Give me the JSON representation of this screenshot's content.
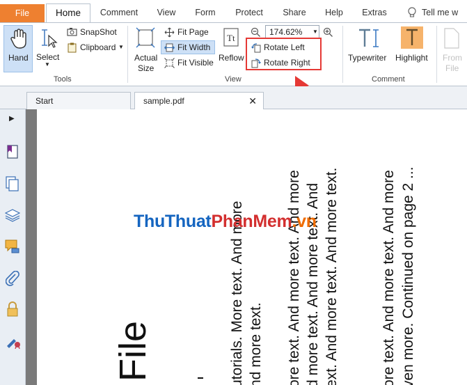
{
  "menu": {
    "tabs": [
      "File",
      "Home",
      "Comment",
      "View",
      "Form",
      "Protect",
      "Share",
      "Help",
      "Extras"
    ],
    "tell_me": "Tell me w"
  },
  "ribbon": {
    "tools": {
      "hand": "Hand",
      "select": "Select",
      "snapshot": "SnapShot",
      "clipboard": "Clipboard",
      "group": "Tools"
    },
    "view": {
      "actual_size_1": "Actual",
      "actual_size_2": "Size",
      "fit_page": "Fit Page",
      "fit_width": "Fit Width",
      "fit_visible": "Fit Visible",
      "reflow": "Reflow",
      "zoom": "174.62%",
      "rotate_left": "Rotate Left",
      "rotate_right": "Rotate Right",
      "group": "View"
    },
    "comment": {
      "typewriter": "Typewriter",
      "highlight": "Highlight",
      "group": "Comment"
    },
    "from_file_1": "From",
    "from_file_2": "File"
  },
  "doc_tabs": {
    "start": "Start",
    "sample": "sample.pdf"
  },
  "document": {
    "title_fragment": "File",
    "col1_line1": "utorials. More text. And more",
    "col1_line2": "nd more text.",
    "col2_line1": "ore text. And more text. And more",
    "col2_line2": "d more text. And more text. And",
    "col2_line3": "ext. And more text. And more text.",
    "col3_line1": "ore text. And more text. And more",
    "col3_line2": "ven more. Continued on page 2 ...",
    "watermark_a": "ThuThuat",
    "watermark_b": "PhanMem",
    "watermark_c": ".vn"
  },
  "colors": {
    "file_tab": "#ee8030",
    "annotation": "#e53935",
    "watermark_blue": "#1565c0",
    "watermark_red": "#d32f2f",
    "watermark_orange": "#ef6c00"
  }
}
